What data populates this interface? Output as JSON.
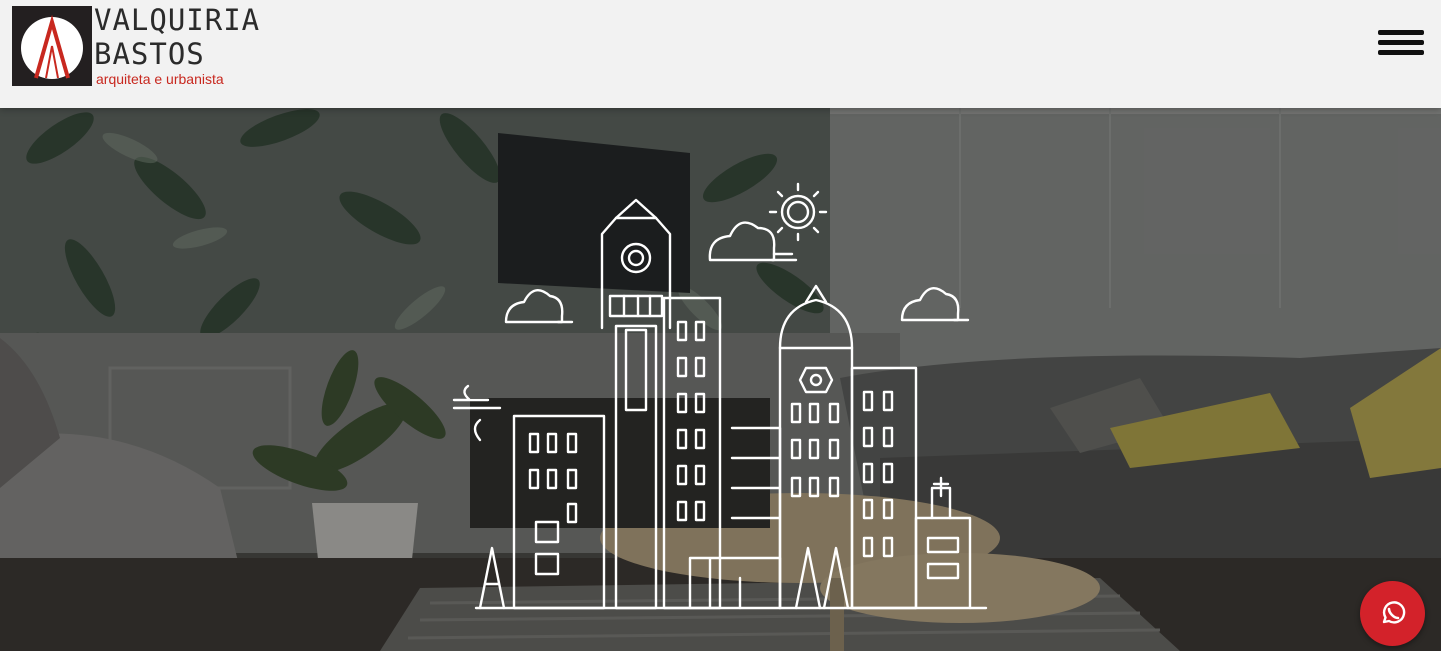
{
  "header": {
    "logo": {
      "title_line1": "VALQUIRIA",
      "title_line2": "BASTOS",
      "subtitle": "arquiteta e urbanista"
    },
    "menu_icon": "hamburger-menu-icon"
  },
  "hero": {
    "illustration_icon": "city-skyline-line-art-icon"
  },
  "floating": {
    "whatsapp_icon": "whatsapp-icon"
  },
  "colors": {
    "brand_red": "#c8281f",
    "header_bg": "#f2f2f2",
    "whatsapp_button": "#d3222a"
  }
}
